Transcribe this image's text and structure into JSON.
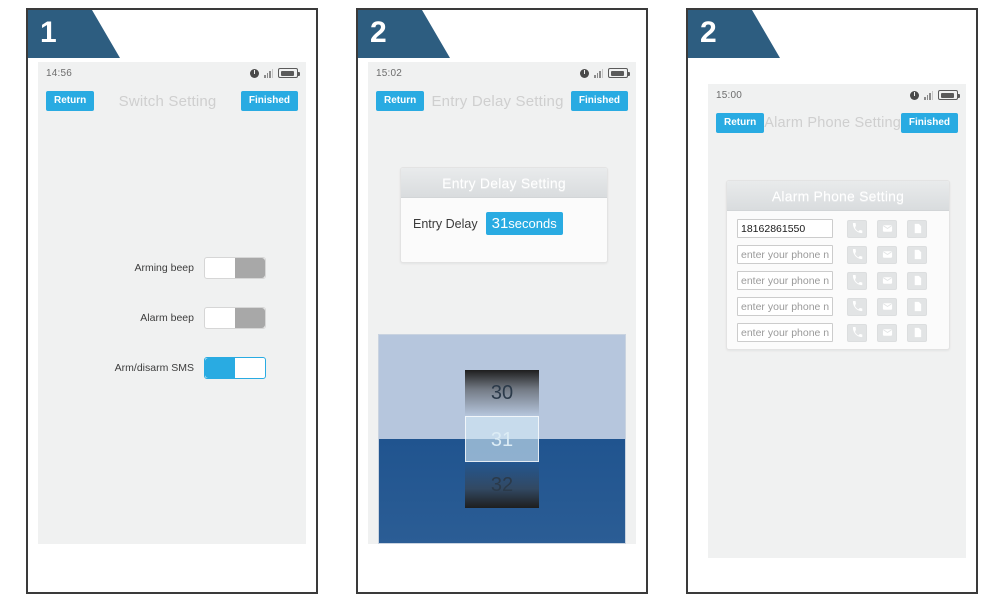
{
  "panels": [
    {
      "badge": "1",
      "status": {
        "time": "14:56",
        "alarm_icon": "alarm-clock-icon",
        "signal_icon": "signal-bars-icon",
        "battery_icon": "battery-icon"
      },
      "nav": {
        "return_label": "Return",
        "title": "Switch Setting",
        "finished_label": "Finished"
      },
      "switches": [
        {
          "label": "Arming beep",
          "state": "off"
        },
        {
          "label": "Alarm beep",
          "state": "off"
        },
        {
          "label": "Arm/disarm SMS",
          "state": "on"
        }
      ]
    },
    {
      "badge": "2",
      "status": {
        "time": "15:02",
        "alarm_icon": "alarm-clock-icon",
        "signal_icon": "signal-bars-icon",
        "battery_icon": "battery-icon"
      },
      "nav": {
        "return_label": "Return",
        "title": "Entry Delay Setting",
        "finished_label": "Finished"
      },
      "card": {
        "header": "Entry Delay Setting",
        "field_label": "Entry Delay",
        "value_number": "31",
        "value_unit": "seconds"
      },
      "picker": {
        "previous": "30",
        "selected": "31",
        "next": "32"
      }
    },
    {
      "badge": "2",
      "status": {
        "time": "15:00",
        "alarm_icon": "alarm-clock-icon",
        "signal_icon": "signal-bars-icon",
        "battery_icon": "battery-icon"
      },
      "nav": {
        "return_label": "Return",
        "title": "Alarm Phone Setting",
        "finished_label": "Finished"
      },
      "card": {
        "header": "Alarm Phone Setting",
        "placeholder": "enter your phone number",
        "rows": [
          {
            "value": "18162861550"
          },
          {
            "value": ""
          },
          {
            "value": ""
          },
          {
            "value": ""
          },
          {
            "value": ""
          }
        ],
        "actions": [
          "call-icon",
          "message-icon",
          "contacts-icon"
        ]
      }
    }
  ],
  "colors": {
    "accent": "#29abe2",
    "badge": "#2d5d80",
    "screen_bg": "#f0f1f1",
    "toggle_off_track": "#a8a8a8",
    "picker_top": "#b6c6dd",
    "picker_bottom": "#20548f"
  }
}
